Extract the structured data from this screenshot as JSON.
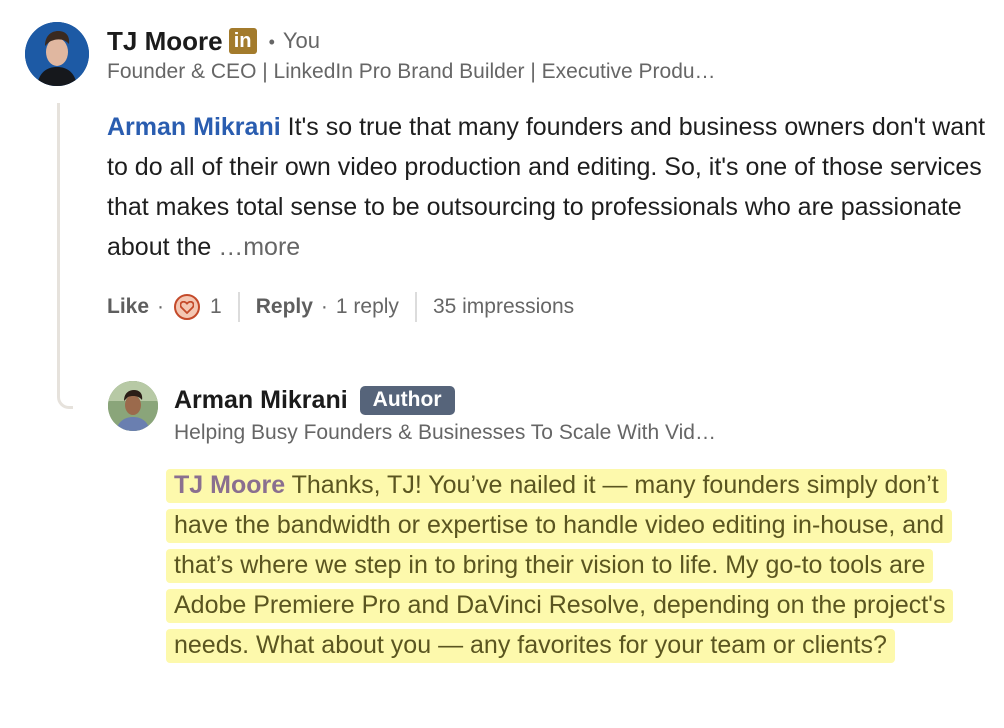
{
  "comment": {
    "author_name": "TJ Moore",
    "linkedin_badge": "in",
    "relation": "You",
    "headline": "Founder & CEO | LinkedIn Pro Brand Builder | Executive Produ…",
    "mention": "Arman Mikrani",
    "text": " It's so true that many founders and business owners don't want to do all of their own video production and editing. So, it's one of those services that makes total sense to be outsourcing to professionals who are passionate about the ",
    "more_label": "…more",
    "actions": {
      "like_label": "Like",
      "reaction_count": "1",
      "reply_label": "Reply",
      "reply_count": "1 reply",
      "impressions": "35 impressions"
    }
  },
  "reply": {
    "author_name": "Arman Mikrani",
    "badge": "Author",
    "headline": "Helping Busy Founders & Businesses To Scale With Vid…",
    "mention": "TJ Moore",
    "text": " Thanks, TJ! You’ve nailed it — many founders simply don’t have the bandwidth or expertise to handle video editing in-house, and that’s where we step in to bring their vision to life. My go-to tools are Adobe Premiere Pro and DaVinci Resolve, depending on the project's needs. What about you — any favorites for your team or clients?"
  },
  "colors": {
    "mention_blue": "#2a5db0",
    "highlight_yellow": "#fdf9ac",
    "author_badge": "#56647a",
    "linkedin_badge": "#a37b2c"
  }
}
